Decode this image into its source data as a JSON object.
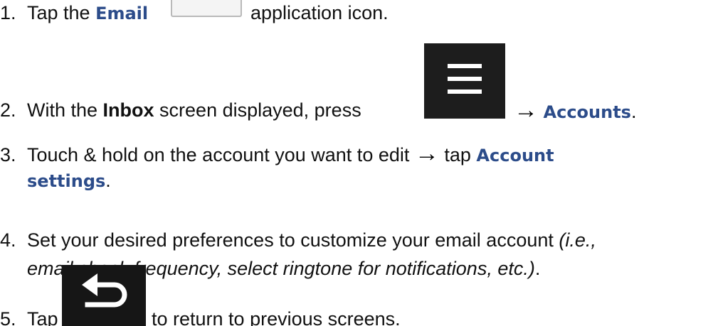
{
  "steps": [
    {
      "number": "1.",
      "before": "Tap the ",
      "ui_term": "Email",
      "after": "application icon.",
      "icon": "email-app-icon"
    },
    {
      "number": "2.",
      "before": "With the ",
      "bold": "Inbox",
      "middle": " screen displayed, press ",
      "icon": "menu-key-icon",
      "arrow": "→",
      "ui_term": "Accounts",
      "end": "."
    },
    {
      "number": "3.",
      "before": "Touch & hold on the account you want to edit ",
      "arrow": "→",
      "middle": " tap ",
      "ui_term_line1": "Account",
      "ui_term_line2": "settings",
      "end": "."
    },
    {
      "number": "4.",
      "before": "Set your desired preferences to customize your email account ",
      "italic_line1": "(i.e.,",
      "italic_line2": "email check frequency, select ringtone for notifications, etc.)",
      "end": "."
    },
    {
      "number": "5.",
      "before": "Tap ",
      "icon": "back-key-icon",
      "after": "to return to previous screens."
    }
  ],
  "colors": {
    "ui_term": "#2c4c8a",
    "key_background": "#1d1d1d",
    "text": "#111111"
  }
}
